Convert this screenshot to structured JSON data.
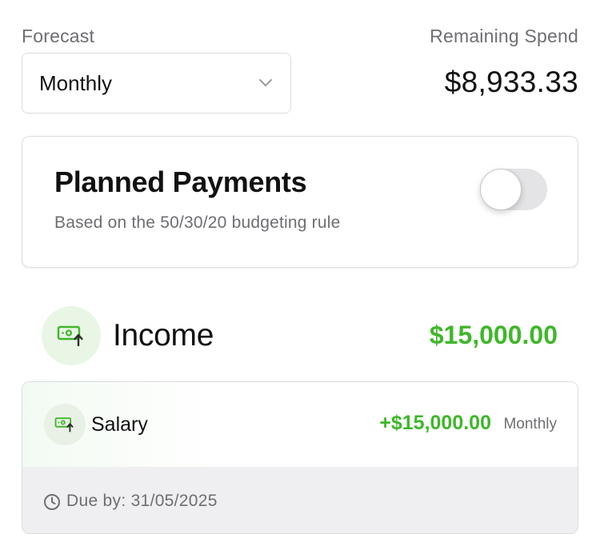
{
  "forecast": {
    "label": "Forecast",
    "selected": "Monthly"
  },
  "remaining": {
    "label": "Remaining Spend",
    "amount": "$8,933.33"
  },
  "planned_payments": {
    "title": "Planned Payments",
    "subtitle": "Based on the 50/30/20 budgeting rule",
    "toggle_on": false
  },
  "income": {
    "title": "Income",
    "total": "$15,000.00",
    "icon": "money-up-icon",
    "items": [
      {
        "name": "Salary",
        "amount": "+$15,000.00",
        "frequency": "Monthly",
        "due": "Due by: 31/05/2025",
        "icon": "money-up-icon"
      }
    ]
  },
  "colors": {
    "positive": "#3fb72a",
    "icon_bg": "#e9f6e6",
    "muted_text": "#6e6e73",
    "border": "#dcdcdf"
  }
}
